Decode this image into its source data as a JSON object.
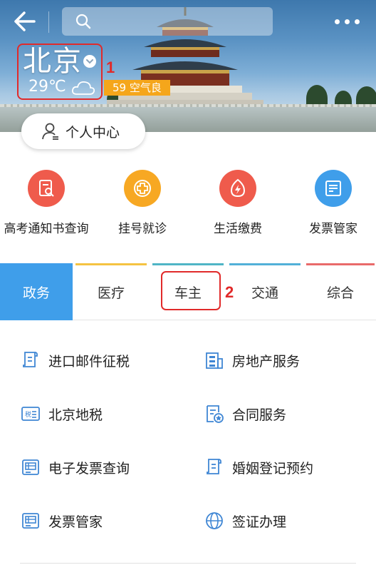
{
  "header": {
    "back_icon": "arrow-left-icon",
    "search_icon": "search-icon",
    "search_placeholder": "",
    "more_icon": "more-dots-icon"
  },
  "city": {
    "name": "北京",
    "temperature": "29℃",
    "weather_icon": "cloud-icon",
    "aqi": "59 空气良",
    "annotation": "1"
  },
  "personal_center": {
    "label": "个人中心",
    "icon": "user-icon"
  },
  "quick_services": [
    {
      "label": "高考通知书查询",
      "icon": "document-search-icon",
      "color": "#ef5b4c"
    },
    {
      "label": "挂号就诊",
      "icon": "medical-cross-icon",
      "color": "#f7a823"
    },
    {
      "label": "生活缴费",
      "icon": "bolt-icon",
      "color": "#ef5b4c"
    },
    {
      "label": "发票管家",
      "icon": "invoice-icon",
      "color": "#3f9eea"
    }
  ],
  "tabs": [
    {
      "label": "政务",
      "active": true,
      "accent": "#3f9eea"
    },
    {
      "label": "医疗",
      "active": false,
      "accent": "#f5c342"
    },
    {
      "label": "车主",
      "active": false,
      "accent": "#4fb5c6"
    },
    {
      "label": "交通",
      "active": false,
      "accent": "#52b0d8"
    },
    {
      "label": "综合",
      "active": false,
      "accent": "#e96a6a"
    }
  ],
  "tab_annotation": "2",
  "services": [
    {
      "label": "进口邮件征税",
      "icon": "receipt-icon"
    },
    {
      "label": "房地产服务",
      "icon": "building-icon"
    },
    {
      "label": "北京地税",
      "icon": "tax-icon"
    },
    {
      "label": "合同服务",
      "icon": "contract-icon"
    },
    {
      "label": "电子发票查询",
      "icon": "invoice-icon"
    },
    {
      "label": "婚姻登记预约",
      "icon": "registration-icon"
    },
    {
      "label": "发票管家",
      "icon": "invoice-icon"
    },
    {
      "label": "签证办理",
      "icon": "globe-icon"
    }
  ],
  "colors": {
    "primary": "#3f9eea",
    "annotation": "#e12a2a",
    "aqi_badge": "#f5a61b",
    "icon_blue": "#3f86d4"
  }
}
